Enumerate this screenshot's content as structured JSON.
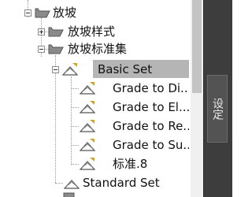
{
  "tree": {
    "nodes": [
      {
        "label": "放坡"
      },
      {
        "label": "放坡样式"
      },
      {
        "label": "放坡标准集"
      },
      {
        "label": "Basic Set"
      },
      {
        "label": "Grade to Di..."
      },
      {
        "label": "Grade to El..."
      },
      {
        "label": "Grade to Re..."
      },
      {
        "label": "Grade to Su..."
      },
      {
        "label": "标准.8"
      },
      {
        "label": "Standard Set"
      }
    ],
    "selected_label": "Basic Set"
  },
  "side_panel": {
    "tab_label": "设定"
  },
  "colors": {
    "selection": "#b5b5b5",
    "panel_bg": "#3d3d3d",
    "tab_bg": "#535353",
    "folder": "#8a8a8a",
    "flag": "#d9a316"
  }
}
